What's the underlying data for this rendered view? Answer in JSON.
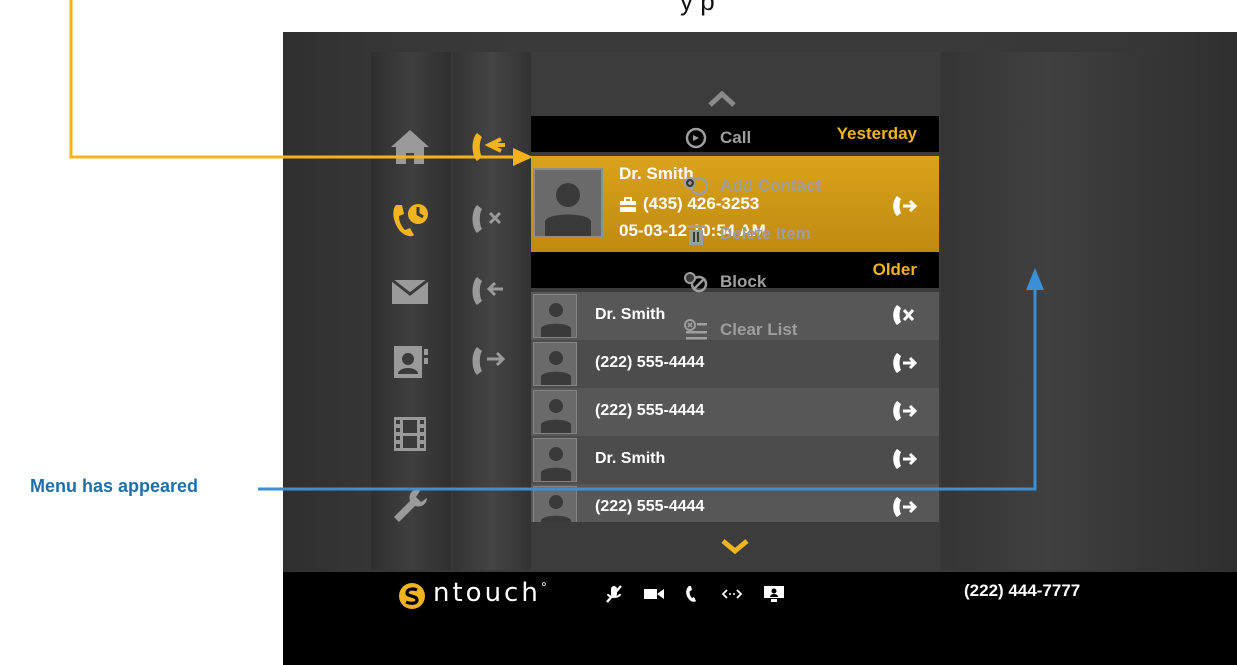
{
  "annotation": {
    "top_caption": "y  p",
    "menu_note": "Menu has appeared",
    "yellow_arrow_color": "#f5b21c",
    "blue_arrow_color": "#3a8fd6"
  },
  "list": {
    "sections": {
      "yesterday": "Yesterday",
      "older": "Older"
    },
    "selected": {
      "name": "Dr. Smith",
      "phone": "(435) 426-3253",
      "datetime": "05-03-12 10:54 AM",
      "phone_type_icon": "briefcase-icon",
      "direction_icon": "outgoing-call-icon"
    },
    "rows": [
      {
        "label": "Dr. Smith",
        "icon": "missed-call-icon"
      },
      {
        "label": "(222) 555-4444",
        "icon": "outgoing-call-icon"
      },
      {
        "label": "(222) 555-4444",
        "icon": "outgoing-call-icon"
      },
      {
        "label": "Dr. Smith",
        "icon": "outgoing-call-icon"
      },
      {
        "label": "(222) 555-4444",
        "icon": "outgoing-call-icon"
      }
    ]
  },
  "menu": {
    "items": [
      {
        "label": "Call",
        "icon": "call-icon"
      },
      {
        "label": "Add Contact",
        "icon": "add-contact-icon"
      },
      {
        "label": "Delete Item",
        "icon": "trash-icon"
      },
      {
        "label": "Block",
        "icon": "block-icon"
      },
      {
        "label": "Clear List",
        "icon": "clear-list-icon"
      }
    ]
  },
  "nav": {
    "main": [
      "home-icon",
      "call-history-icon",
      "mail-icon",
      "contacts-icon",
      "video-icon",
      "settings-icon"
    ],
    "filters": [
      "all-calls-icon",
      "missed-calls-icon",
      "received-calls-icon",
      "dialed-calls-icon"
    ]
  },
  "status_bar": {
    "brand": "ntouch",
    "brand_mark": "°",
    "my_phone": "(222) 444-7777",
    "icons": [
      "mic-muted-icon",
      "video-camera-icon",
      "phone-icon",
      "network-icon",
      "monitor-icon"
    ]
  },
  "colors": {
    "accent": "#f0b41e",
    "selected_row": "#c99414",
    "menu_text": "#9e9e9e"
  }
}
